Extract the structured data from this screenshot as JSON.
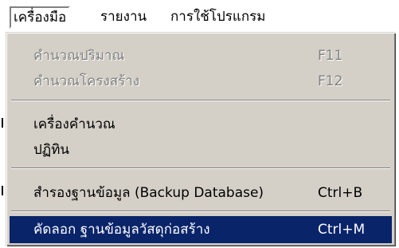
{
  "menubar": {
    "items": [
      {
        "label": "เครื่องมือ"
      },
      {
        "label": "รายงาน"
      },
      {
        "label": "การใช้โปรแกรม"
      }
    ]
  },
  "dropdown": {
    "items": [
      {
        "label": "คำนวณปริมาณ",
        "shortcut": "F11",
        "disabled": true
      },
      {
        "label": "คำนวณโครงสร้าง",
        "shortcut": "F12",
        "disabled": true
      },
      {
        "label": "เครื่องคำนวณ",
        "shortcut": "",
        "disabled": false
      },
      {
        "label": "ปฏิทิน",
        "shortcut": "",
        "disabled": false
      },
      {
        "label": "สำรองฐานข้อมูล (Backup Database)",
        "shortcut": "Ctrl+B",
        "disabled": false
      },
      {
        "label": "คัดลอก ฐานข้อมูลวัสดุก่อสร้าง",
        "shortcut": "Ctrl+M",
        "disabled": false,
        "highlighted": true
      }
    ]
  },
  "colors": {
    "menu_background": "#d4d0c8",
    "highlight_background": "#0a246a",
    "highlight_text": "#ffffff",
    "disabled_text": "#808080"
  }
}
